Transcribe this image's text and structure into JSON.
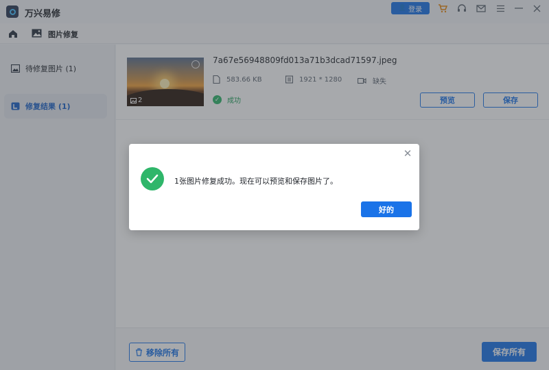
{
  "app": {
    "title": "万兴易修",
    "login_label": "登录"
  },
  "nav": {
    "title": "图片修复"
  },
  "sidebar": {
    "items": [
      {
        "label": "待修复图片 (1)",
        "active": false
      },
      {
        "label": "修复结果 (1)",
        "active": true
      }
    ]
  },
  "result": {
    "file_name": "7a67e56948809fd013a71b3dcad71597.jpeg",
    "thumb_count": "2",
    "size": "583.66 KB",
    "resolution": "1921 * 1280",
    "video_meta": "缺失",
    "status": "成功",
    "preview_label": "预览",
    "save_label": "保存"
  },
  "footer": {
    "remove_all_label": "移除所有",
    "save_all_label": "保存所有"
  },
  "dialog": {
    "message": "1张图片修复成功。现在可以预览和保存图片了。",
    "ok_label": "好的"
  },
  "colors": {
    "accent": "#1a73e8",
    "success": "#2fb66a"
  }
}
